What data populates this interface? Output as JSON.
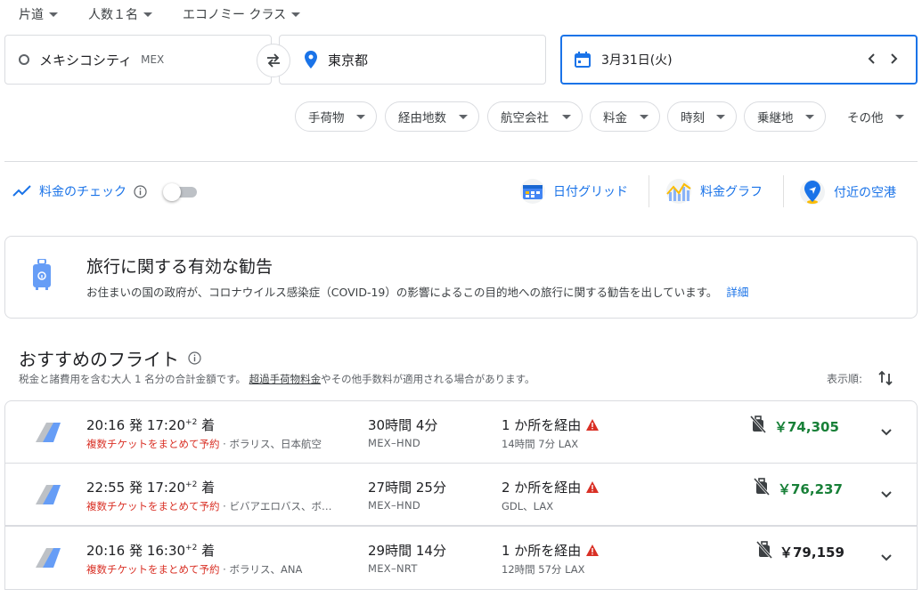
{
  "top_selectors": {
    "trip_type": "片道",
    "passengers": "人数１名",
    "cabin_class": "エコノミー クラス"
  },
  "search": {
    "origin_city": "メキシコシティ",
    "origin_code": "MEX",
    "destination": "東京都",
    "date": "3月31日(火)"
  },
  "filters": [
    "手荷物",
    "経由地数",
    "航空会社",
    "料金",
    "時刻",
    "乗継地",
    "その他"
  ],
  "tools": {
    "price_tracking": "料金のチェック",
    "date_grid": "日付グリッド",
    "price_graph": "料金グラフ",
    "nearby_airports": "付近の空港"
  },
  "advisory": {
    "title": "旅行に関する有効な勧告",
    "body": "お住まいの国の政府が、コロナウイルス感染症（COVID-19）の影響によるこの目的地への旅行に関する勧告を出しています。",
    "link": "詳細"
  },
  "results": {
    "heading": "おすすめのフライト",
    "note_before": "税金と諸費用を含む大人 1 名分の合計金額です。",
    "note_link": "超過手荷物料金",
    "note_after": "やその他手数料が適用される場合があります。",
    "sort_label": "表示順:"
  },
  "flights": [
    {
      "depart": "20:16",
      "depart_label": "発",
      "arrive": "17:20",
      "day_offset": "+2",
      "arrive_label": "着",
      "booking_note": "複数チケットをまとめて予約",
      "airlines": "ボラリス、日本航空",
      "duration": "30時間 4分",
      "route": "MEX–HND",
      "stops": "1 か所を経由",
      "stop_detail": "14時間 7分 LAX",
      "price": "￥74,305",
      "price_color": "#188038"
    },
    {
      "depart": "22:55",
      "depart_label": "発",
      "arrive": "17:20",
      "day_offset": "+2",
      "arrive_label": "着",
      "booking_note": "複数チケットをまとめて予約",
      "airlines": "ビバアエロバス、ボ…",
      "duration": "27時間 25分",
      "route": "MEX–HND",
      "stops": "2 か所を経由",
      "stop_detail": "GDL、LAX",
      "price": "￥76,237",
      "price_color": "#188038"
    },
    {
      "depart": "20:16",
      "depart_label": "発",
      "arrive": "16:30",
      "day_offset": "+2",
      "arrive_label": "着",
      "booking_note": "複数チケットをまとめて予約",
      "airlines": "ボラリス、ANA",
      "duration": "29時間 14分",
      "route": "MEX–NRT",
      "stops": "1 か所を経由",
      "stop_detail": "12時間 57分 LAX",
      "price": "￥79,159",
      "price_color": "#202124"
    }
  ],
  "colors": {
    "accent": "#1a73e8",
    "warning": "#d93025",
    "price_low": "#188038"
  }
}
